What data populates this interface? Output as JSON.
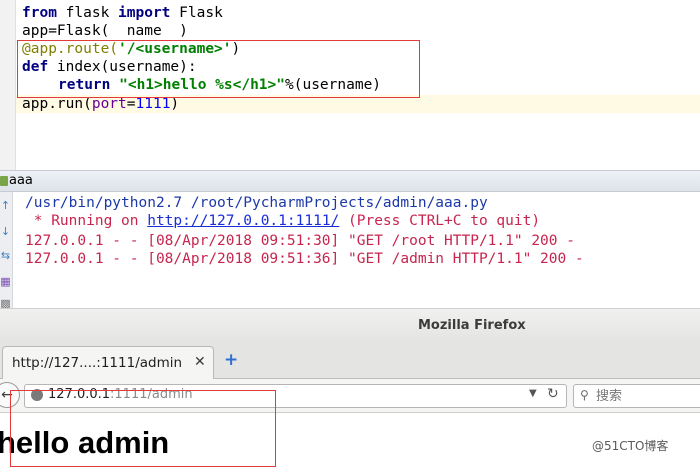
{
  "editor": {
    "code_line_1": [
      "from",
      " flask ",
      "import",
      " Flask"
    ],
    "code_line_2": "app=Flask(  name  )",
    "code_line_3": [
      "@app.route(",
      "'/<username>'",
      ")"
    ],
    "code_line_4": [
      "def",
      " index(username):"
    ],
    "code_line_5": [
      "return",
      " ",
      "\"<h1>hello %s</h1>\"",
      "%(username)"
    ],
    "code_line_6": [
      "app.run(",
      "port",
      "=",
      "1111",
      ")"
    ]
  },
  "run_panel": {
    "tab_label": "aaa",
    "output": [
      "/usr/bin/python2.7 /root/PycharmProjects/admin/aaa.py",
      " * Running on ",
      "http://127.0.0.1:1111/",
      " (Press CTRL+C to quit)",
      "127.0.0.1 - - [08/Apr/2018 09:51:30] \"GET /root HTTP/1.1\" 200 -",
      "127.0.0.1 - - [08/Apr/2018 09:51:36] \"GET /admin HTTP/1.1\" 200 -"
    ]
  },
  "firefox": {
    "window_title": "Mozilla Firefox",
    "tab_label": "http://127....:1111/admin",
    "url_host": "127.0.0.1",
    "url_rest": ":1111/admin",
    "search_placeholder": "搜索",
    "page_heading": "hello admin"
  },
  "watermark": "@51CTO博客",
  "colors": {
    "annotation_red": "#e13b3b",
    "keyword": "#000080",
    "string": "#008000",
    "log_red": "#c7254e",
    "link_blue": "#1a2ed8"
  }
}
